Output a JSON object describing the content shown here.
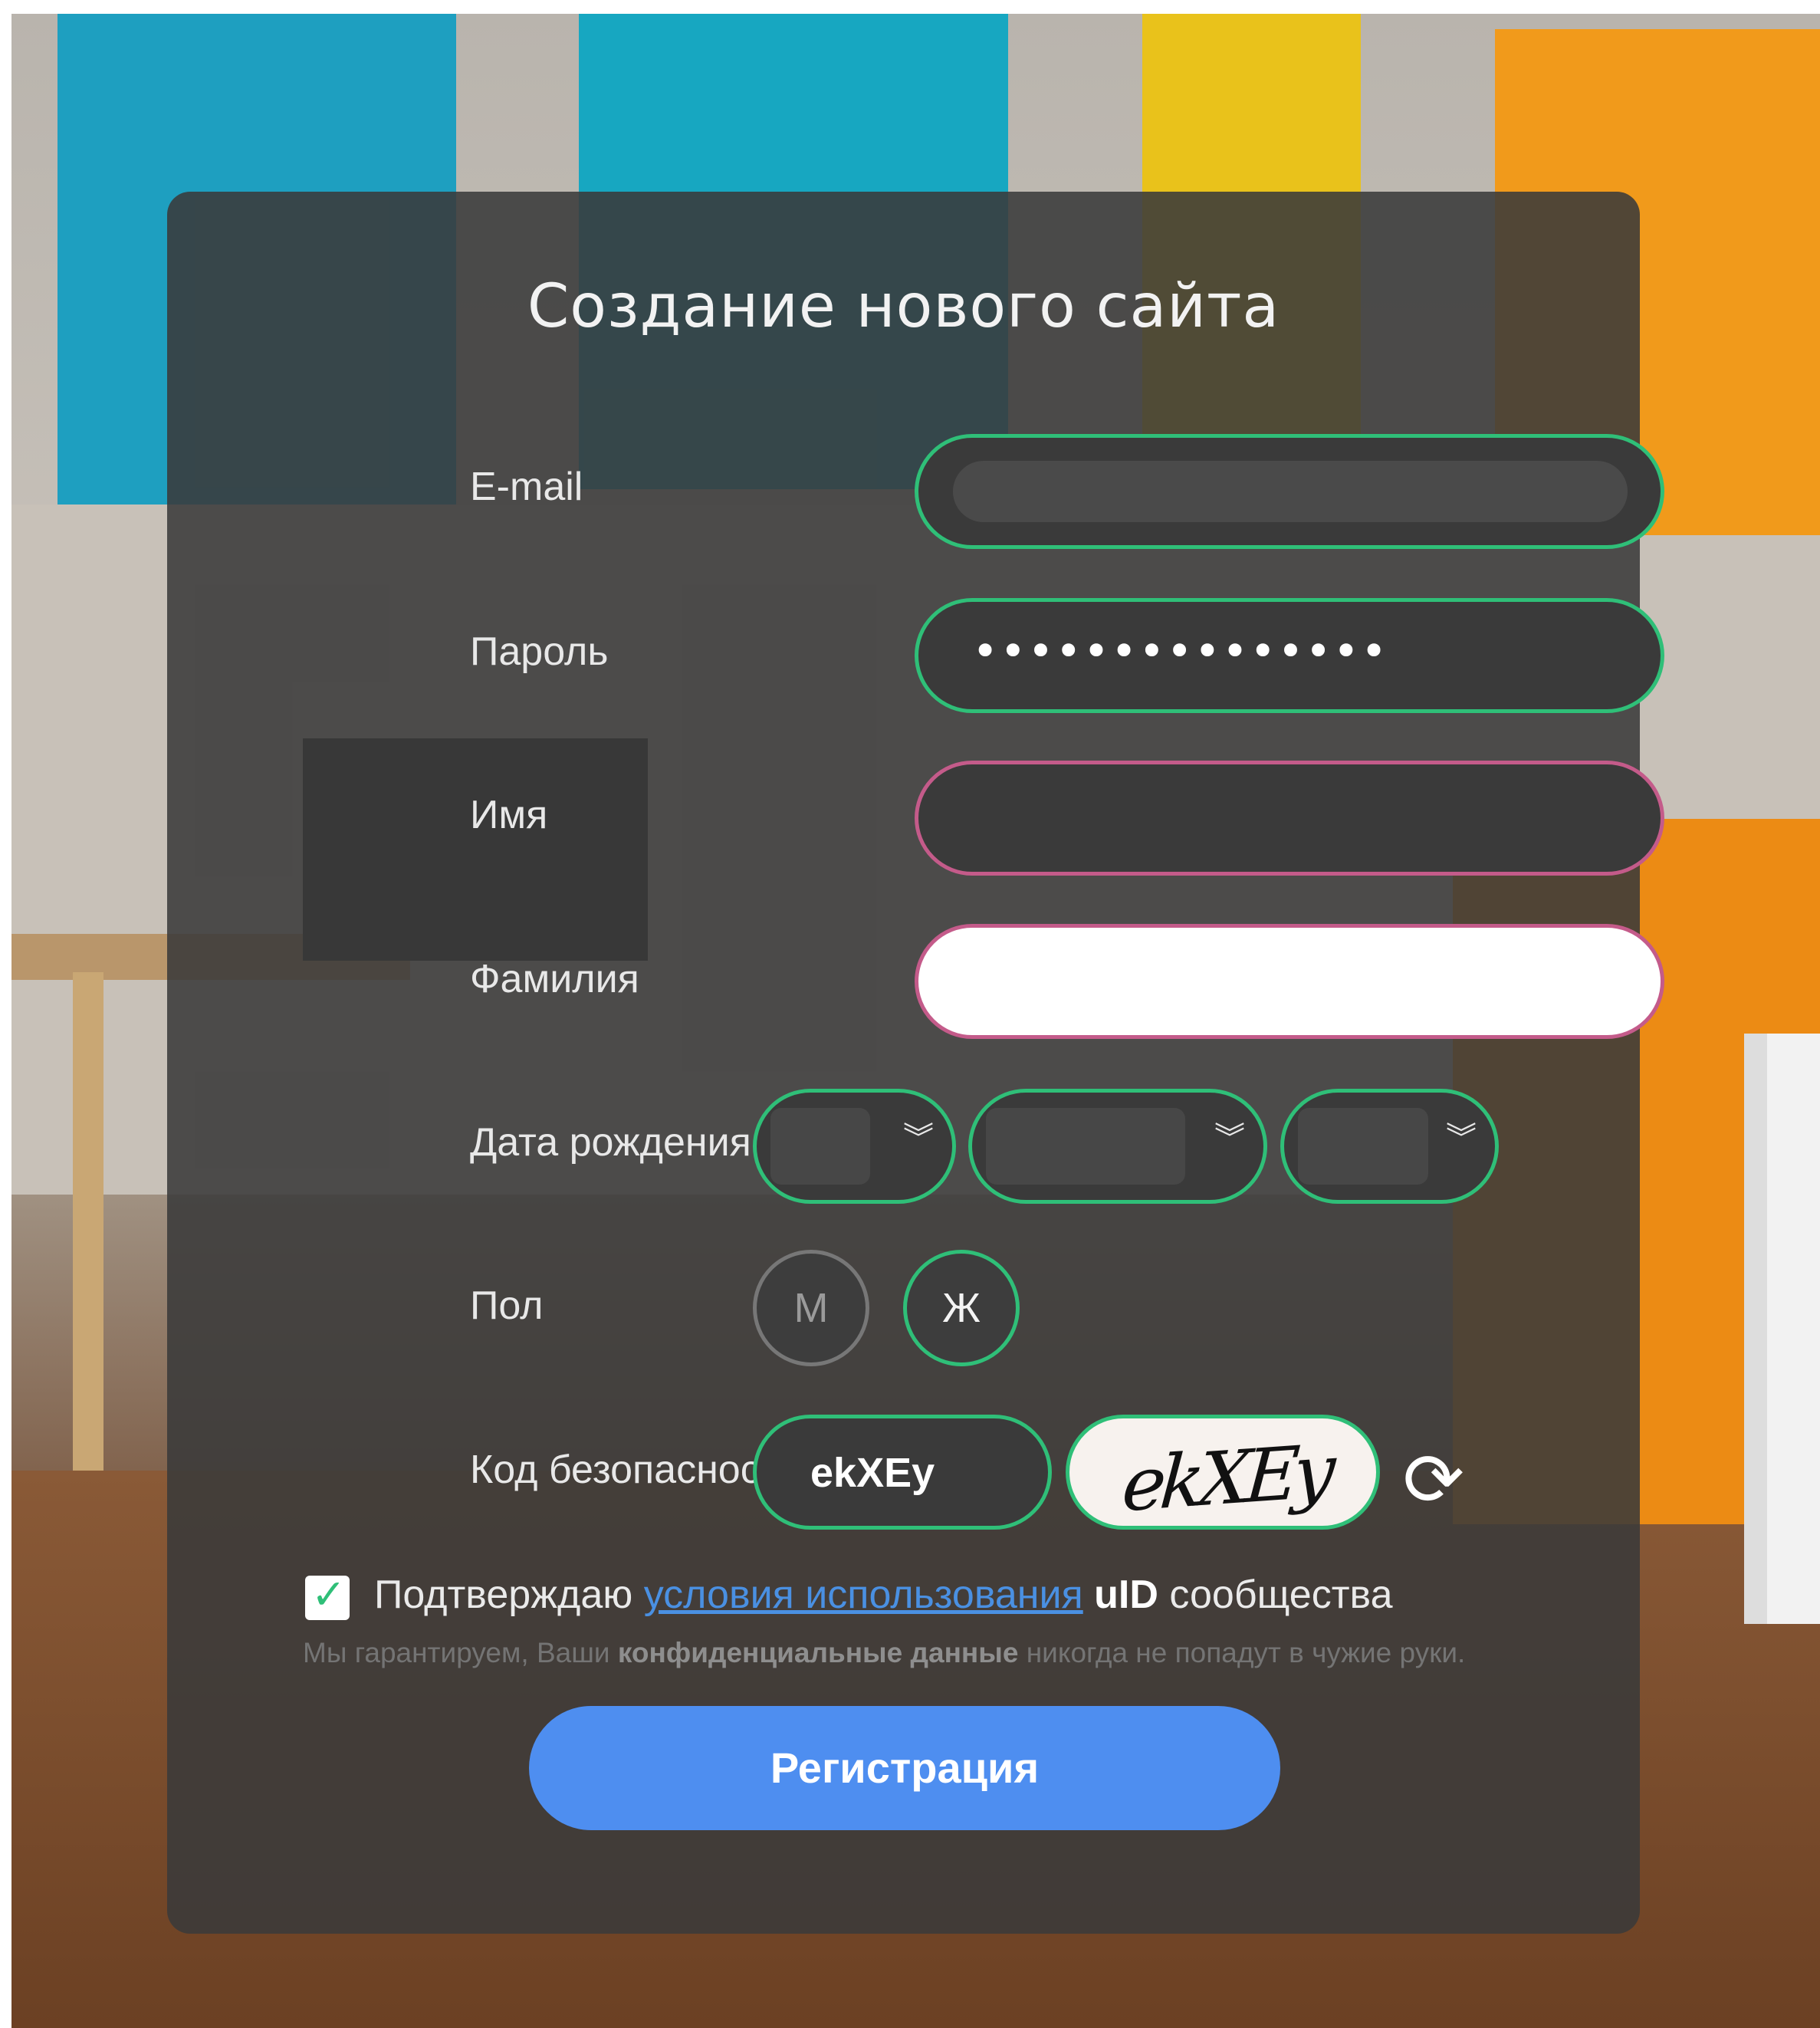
{
  "form": {
    "title": "Создание нового сайта",
    "labels": {
      "email": "E-mail",
      "password": "Пароль",
      "first_name": "Имя",
      "last_name": "Фамилия",
      "birth_date": "Дата рождения",
      "gender": "Пол",
      "security_code": "Код безопасности"
    },
    "password_value": "•••••••••••••••",
    "gender_options": [
      "М",
      "Ж"
    ],
    "gender_selected": "Ж",
    "security_code_value": "ekXEy",
    "captcha_text": "ekXEy",
    "agree": {
      "prefix": "Подтверждаю",
      "link": "условия использования",
      "brand": "uID",
      "suffix": "сообщества",
      "checked": true
    },
    "privacy": {
      "prefix": "Мы гарантируем, Ваши",
      "bold": "конфиденциальные данные",
      "suffix": "никогда не попадут в чужие руки."
    },
    "submit_label": "Регистрация"
  },
  "colors": {
    "accent_green": "#2fbf78",
    "error_pink": "#c45b8a",
    "button_blue": "#4e8ef0",
    "link_blue": "#4a90e2"
  },
  "icons": {
    "select_chevron": "chevron-down-double-icon",
    "refresh": "refresh-icon",
    "checkbox": "checkmark-icon"
  }
}
